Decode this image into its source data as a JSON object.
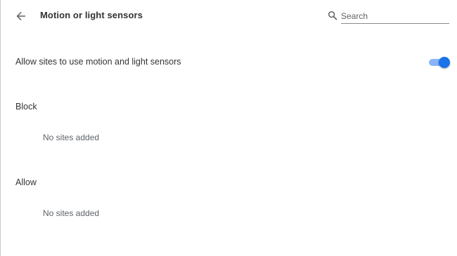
{
  "header": {
    "title": "Motion or light sensors",
    "back_icon": "arrow-back-icon",
    "search_placeholder": "Search",
    "search_value": "",
    "search_icon": "search-icon"
  },
  "setting": {
    "label": "Allow sites to use motion and light sensors",
    "enabled": true
  },
  "sections": {
    "block": {
      "heading": "Block",
      "empty_text": "No sites added"
    },
    "allow": {
      "heading": "Allow",
      "empty_text": "No sites added"
    }
  },
  "colors": {
    "accent": "#1a73e8",
    "accent_track": "#8ab4f8"
  }
}
